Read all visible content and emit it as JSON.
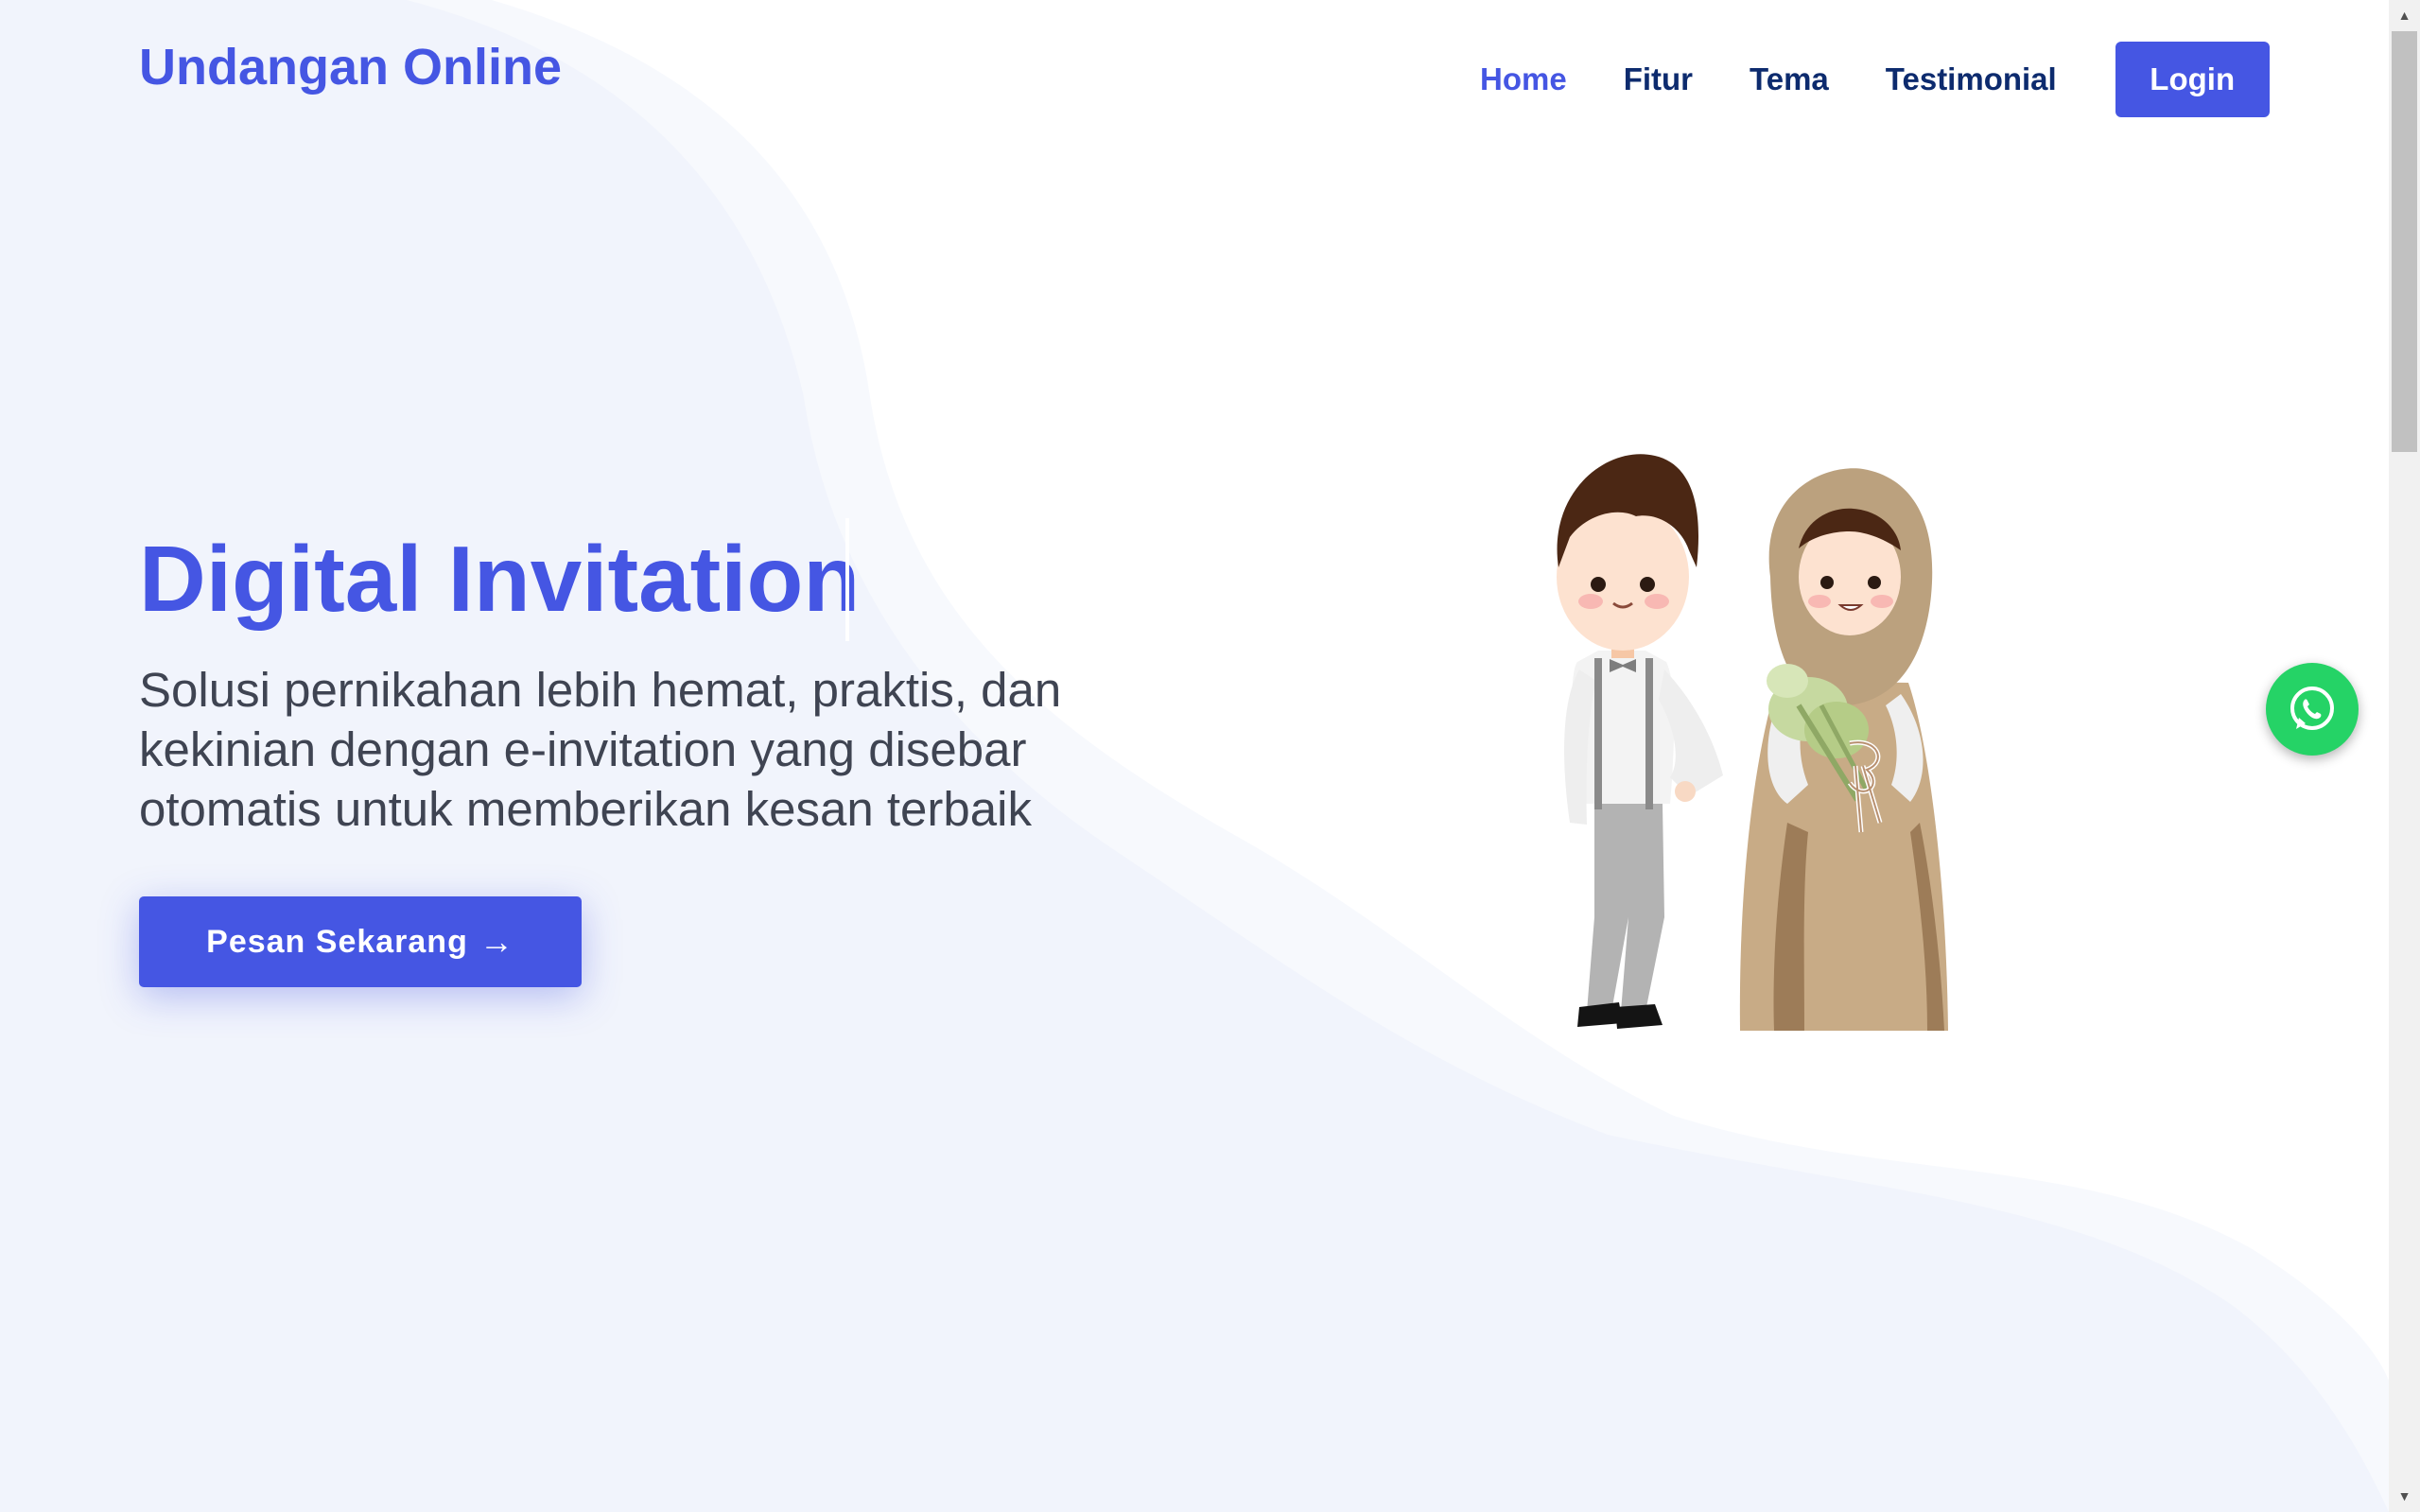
{
  "header": {
    "logo": "Undangan Online",
    "nav": [
      {
        "label": "Home",
        "active": true
      },
      {
        "label": "Fitur",
        "active": false
      },
      {
        "label": "Tema",
        "active": false
      },
      {
        "label": "Testimonial",
        "active": false
      }
    ],
    "login_label": "Login"
  },
  "hero": {
    "title": "Digital Invitation",
    "subtitle": "Solusi pernikahan lebih hemat, praktis, dan kekinian dengan e-invitation yang disebar otomatis untuk memberikan kesan terbaik",
    "cta_label": "Pesan Sekarang",
    "cta_arrow": "→",
    "illustration": "cartoon-couple-groom-and-bride"
  },
  "floating": {
    "icon": "whatsapp-icon"
  },
  "colors": {
    "primary": "#4556e3",
    "nav_text": "#0d2b6e",
    "body_text": "#3f4452",
    "whatsapp": "#25d366",
    "bg_shape": "#f1f4fc"
  }
}
